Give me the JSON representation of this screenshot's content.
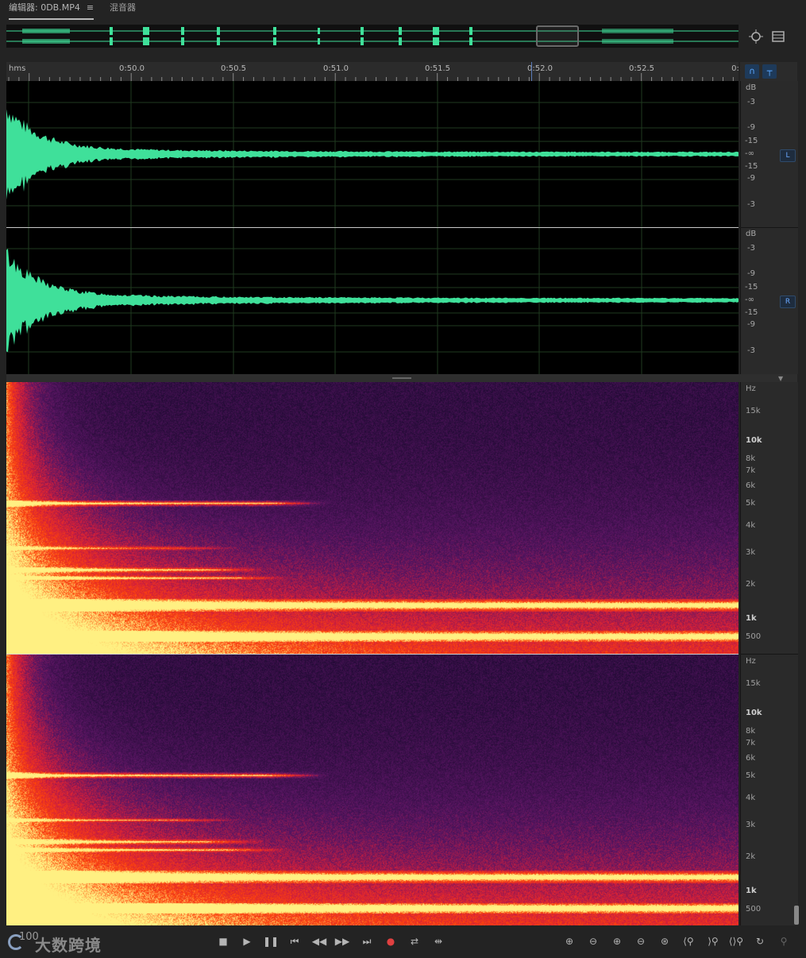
{
  "tabs": {
    "editor": "编辑器: 0DB.MP4",
    "editor_menu": "≡",
    "mixer": "混音器"
  },
  "ruler": {
    "unit": "hms",
    "ticks": [
      "0:50.0",
      "0:50.5",
      "0:51.0",
      "0:51.5",
      "0:52.0",
      "0:52.5",
      "0:"
    ]
  },
  "waveform": {
    "db_unit": "dB",
    "db_labels": [
      "-3",
      "-9",
      "-15",
      "-∞",
      "-15",
      "-9",
      "-3"
    ],
    "channels": [
      "L",
      "R"
    ],
    "color": "#3fe09a"
  },
  "spectrum": {
    "unit": "Hz",
    "labels": [
      "15k",
      "10k",
      "8k",
      "7k",
      "6k",
      "5k",
      "4k",
      "3k",
      "2k",
      "1k",
      "500"
    ]
  },
  "watermark": {
    "number": "100",
    "text": "大数跨境"
  },
  "icons": {
    "zoom_nav": "zoom-navigator-icon",
    "list": "list-icon"
  }
}
